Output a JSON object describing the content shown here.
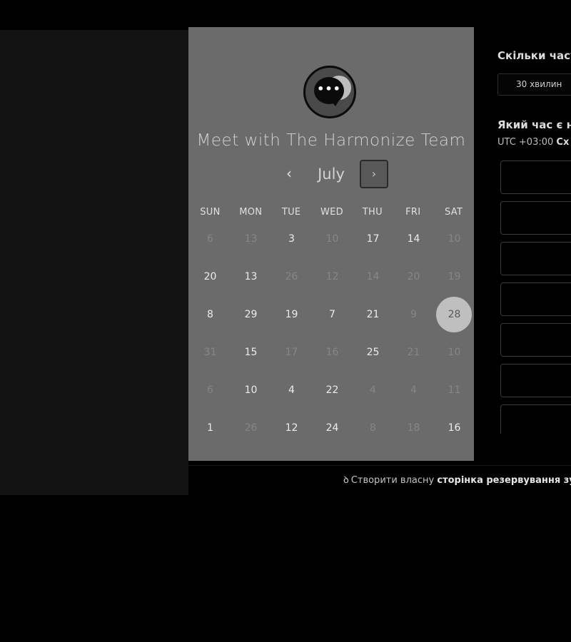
{
  "calendar": {
    "team_title": "Meet with The Harmonize Team",
    "month": "July",
    "prev_icon": "‹",
    "next_icon": "›",
    "weekdays": [
      "SUN",
      "MON",
      "TUE",
      "WED",
      "THU",
      "FRI",
      "SAT"
    ],
    "weeks": [
      [
        {
          "d": "6",
          "dim": true
        },
        {
          "d": "13",
          "dim": true
        },
        {
          "d": "3",
          "dim": false
        },
        {
          "d": "10",
          "dim": true
        },
        {
          "d": "17",
          "dim": false
        },
        {
          "d": "14",
          "dim": false
        },
        {
          "d": "10",
          "dim": true
        }
      ],
      [
        {
          "d": "20",
          "dim": false
        },
        {
          "d": "13",
          "dim": false
        },
        {
          "d": "26",
          "dim": true
        },
        {
          "d": "12",
          "dim": true
        },
        {
          "d": "14",
          "dim": true
        },
        {
          "d": "20",
          "dim": true
        },
        {
          "d": "19",
          "dim": true
        }
      ],
      [
        {
          "d": "8",
          "dim": false
        },
        {
          "d": "29",
          "dim": false
        },
        {
          "d": "19",
          "dim": false
        },
        {
          "d": "7",
          "dim": false
        },
        {
          "d": "21",
          "dim": false
        },
        {
          "d": "9",
          "dim": true
        },
        {
          "d": "28",
          "dim": false,
          "selected": true
        }
      ],
      [
        {
          "d": "31",
          "dim": true
        },
        {
          "d": "15",
          "dim": false
        },
        {
          "d": "17",
          "dim": true
        },
        {
          "d": "16",
          "dim": true
        },
        {
          "d": "25",
          "dim": false
        },
        {
          "d": "21",
          "dim": true
        },
        {
          "d": "10",
          "dim": true
        }
      ],
      [
        {
          "d": "6",
          "dim": true
        },
        {
          "d": "10",
          "dim": false
        },
        {
          "d": "4",
          "dim": false
        },
        {
          "d": "22",
          "dim": false
        },
        {
          "d": "4",
          "dim": true
        },
        {
          "d": "4",
          "dim": true
        },
        {
          "d": "11",
          "dim": true
        }
      ],
      [
        {
          "d": "1",
          "dim": false
        },
        {
          "d": "26",
          "dim": true
        },
        {
          "d": "12",
          "dim": false
        },
        {
          "d": "24",
          "dim": false
        },
        {
          "d": "8",
          "dim": true
        },
        {
          "d": "18",
          "dim": true
        },
        {
          "d": "16",
          "dim": false
        }
      ]
    ]
  },
  "booking": {
    "duration_question": "Скільки часу",
    "duration_option": "30 хвилин",
    "time_question": "Який час є на",
    "timezone_prefix": "UTC +03:00",
    "timezone_name": "Сх",
    "slot_count": 7
  },
  "footer": {
    "icon": "sprocket-icon",
    "text_plain": "Створити власну",
    "text_bold": "сторінка резервування зус"
  },
  "colors": {
    "panel_gray": "#6b6b6b",
    "selected_day": "#bfbfbf",
    "background": "#000000"
  }
}
